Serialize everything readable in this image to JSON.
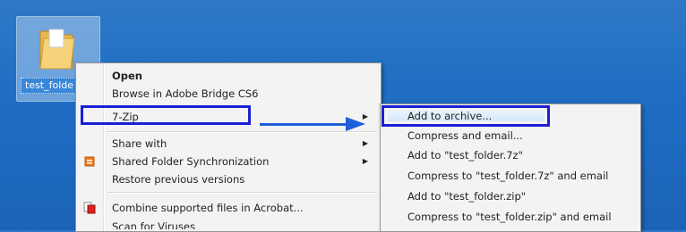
{
  "desktop": {
    "folder_label": "test_folde"
  },
  "context_menu": {
    "items": [
      {
        "label": "Open",
        "bold": true
      },
      {
        "label": "Browse in Adobe Bridge CS6"
      },
      {
        "label": "7-Zip",
        "submenu": true
      },
      {
        "label": "Share with",
        "submenu": true
      },
      {
        "label": "Shared Folder Synchronization",
        "submenu": true
      },
      {
        "label": "Restore previous versions"
      },
      {
        "label": "Combine supported files in Acrobat..."
      },
      {
        "label": "Scan for Viruses"
      }
    ],
    "submenu_arrow": "▶"
  },
  "zip_submenu": {
    "items": [
      {
        "label": "Add to archive..."
      },
      {
        "label": "Compress and email..."
      },
      {
        "label": "Add to \"test_folder.7z\""
      },
      {
        "label": "Compress to \"test_folder.7z\" and email"
      },
      {
        "label": "Add to \"test_folder.zip\""
      },
      {
        "label": "Compress to \"test_folder.zip\" and email"
      }
    ]
  },
  "colors": {
    "highlight_border": "#1a1fd6",
    "arrow": "#1d5fd8"
  },
  "icons": {
    "folder": "folder-icon",
    "shared_sync": "sync-icon",
    "acrobat": "acrobat-icon",
    "submenu_arrow": "chevron-right-icon"
  }
}
